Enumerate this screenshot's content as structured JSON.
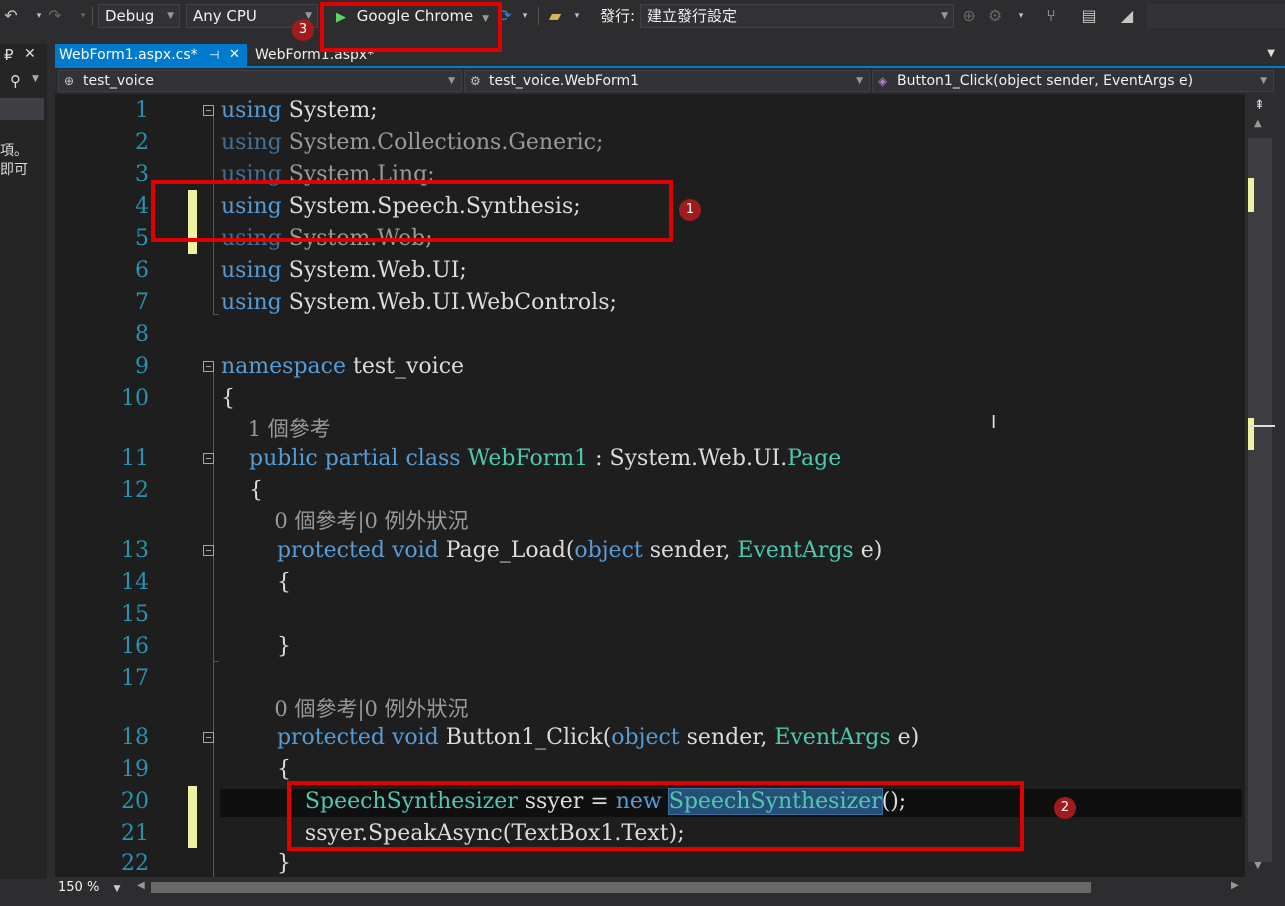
{
  "toolbar": {
    "configuration": "Debug",
    "platform": "Any CPU",
    "run_target": "Google Chrome",
    "publish_label": "發行:",
    "publish_profile": "建立發行設定",
    "badge3": "3"
  },
  "left_panel": {
    "pin_glyph": "ᴘ",
    "close_glyph": "✕",
    "search_glyph": "🔍",
    "text_line1": "項。",
    "text_line2": "即可"
  },
  "tabs": [
    {
      "label": "WebForm1.aspx.cs*",
      "active": true
    },
    {
      "label": "WebForm1.aspx*",
      "active": false
    }
  ],
  "navbar": {
    "project": "test_voice",
    "class": "test_voice.WebForm1",
    "member": "Button1_Click(object sender, EventArgs e)"
  },
  "editor": {
    "zoom": "150 %",
    "codelens_class": "1 個參考",
    "codelens_method": "0 個參考|0 例外狀況",
    "line_numbers": [
      "1",
      "2",
      "3",
      "4",
      "5",
      "6",
      "7",
      "8",
      "9",
      "10",
      "11",
      "12",
      "13",
      "14",
      "15",
      "16",
      "17",
      "18",
      "19",
      "20",
      "21",
      "22"
    ]
  },
  "annotations": {
    "badge1": "1",
    "badge2": "2"
  },
  "colors": {
    "keyword": "#569cd6",
    "type": "#4ec9b0",
    "text": "#dcdcdc",
    "line_number": "#2b91af",
    "accent": "#007acc",
    "highlight_box": "#e00000"
  }
}
